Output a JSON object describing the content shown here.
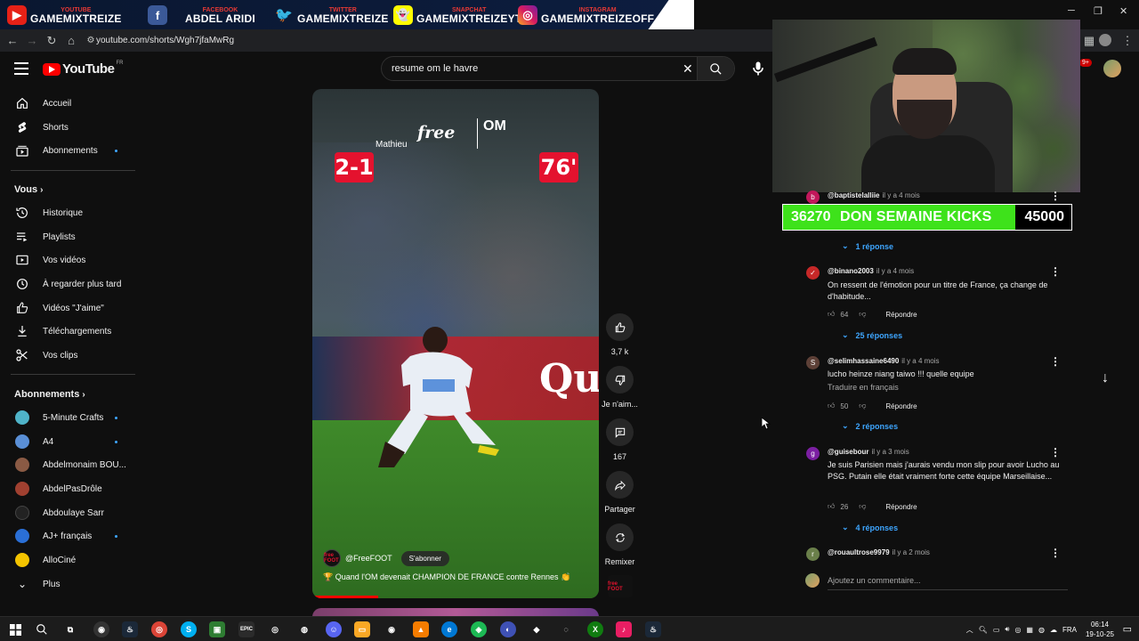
{
  "banner": {
    "youtube": {
      "small": "YOUTUBE",
      "big": "GAMEMIXTREIZE"
    },
    "facebook": {
      "small": "FACEBOOK",
      "big": "ABDEL ARIDI"
    },
    "twitter": {
      "small": "TWITTER",
      "big": "GAMEMIXTREIZE"
    },
    "snapchat": {
      "small": "SNAPCHAT",
      "big": "GAMEMIXTREIZEYT"
    },
    "instagram": {
      "small": "INSTAGRAM",
      "big": "GAMEMIXTREIZEOFF"
    }
  },
  "browser": {
    "url": "youtube.com/shorts/Wgh7jfaMwRg"
  },
  "header": {
    "logo_text": "YouTube",
    "country": "FR",
    "search_query": "resume om le havre",
    "notif_badge": "9+"
  },
  "sidebar": {
    "main": [
      {
        "label": "Accueil",
        "icon": "home-icon"
      },
      {
        "label": "Shorts",
        "icon": "shorts-icon"
      },
      {
        "label": "Abonnements",
        "icon": "subscriptions-icon"
      }
    ],
    "you_heading": "Vous",
    "you": [
      {
        "label": "Historique",
        "icon": "history-icon"
      },
      {
        "label": "Playlists",
        "icon": "playlists-icon"
      },
      {
        "label": "Vos vidéos",
        "icon": "your-videos-icon"
      },
      {
        "label": "À regarder plus tard",
        "icon": "watch-later-icon"
      },
      {
        "label": "Vidéos \"J'aime\"",
        "icon": "liked-videos-icon"
      },
      {
        "label": "Téléchargements",
        "icon": "downloads-icon"
      },
      {
        "label": "Vos clips",
        "icon": "clips-icon"
      }
    ],
    "subs_heading": "Abonnements",
    "subs": [
      {
        "label": "5-Minute Crafts",
        "color": "#4fb3c8"
      },
      {
        "label": "A4",
        "color": "#5a8fd6"
      },
      {
        "label": "Abdelmonaim BOU...",
        "color": "#8a5a44"
      },
      {
        "label": "AbdelPasDrôle",
        "color": "#a04030"
      },
      {
        "label": "Abdoulaye Sarr",
        "color": "#222222"
      },
      {
        "label": "AJ+ français",
        "color": "#2a6fd6"
      },
      {
        "label": "AlloCiné",
        "color": "#f4c400"
      }
    ],
    "more": "Plus"
  },
  "video": {
    "score_left": "2-1",
    "score_right": "76'",
    "scorer": "Mathieu",
    "sponsor": "free",
    "club": "OM",
    "channel": "@FreeFOOT",
    "channel_avatar": "free FOOT",
    "subscribe": "S'abonner",
    "caption": "🏆 Quand l'OM devenait CHAMPION DE FRANCE contre Rennes 👏",
    "progress": 0.23
  },
  "actions": {
    "like_count": "3,7 k",
    "dislike_label": "Je n'aim...",
    "comment_count": "167",
    "share_label": "Partager",
    "remix_label": "Remixer"
  },
  "donation": {
    "current": "36270",
    "title": "DON SEMAINE KICKS",
    "goal": "45000",
    "progress": 0.806
  },
  "comments": [
    {
      "user": "@baptistelalliie",
      "time": "il y a 4 mois",
      "avatar": "b",
      "color": "#c2185b",
      "text": "",
      "likes": "",
      "replies": "1 réponse"
    },
    {
      "user": "@binano2003",
      "time": "il y a 4 mois",
      "avatar": "✓",
      "color": "#c62828",
      "text": "On ressent de l'émotion pour un titre de France, ça change de d'habitude...",
      "likes": "64",
      "replies": "25 réponses"
    },
    {
      "user": "@selimhassaine6490",
      "time": "il y a 4 mois",
      "avatar": "S",
      "color": "#5d4037",
      "text": "lucho heinze niang taiwo !!! quelle equipe",
      "translate": "Traduire en français",
      "likes": "50",
      "replies": "2 réponses"
    },
    {
      "user": "@guisebour",
      "time": "il y a 3 mois",
      "avatar": "g",
      "color": "#7b1fa2",
      "text": "Je suis Parisien mais j'aurais vendu mon slip pour avoir Lucho au PSG. Putain elle était vraiment forte cette équipe Marseillaise...",
      "likes": "26",
      "replies": "4 réponses"
    },
    {
      "user": "@rouaultrose9979",
      "time": "il y a 2 mois",
      "avatar": "r",
      "color": "#6a7f4a",
      "text": "",
      "likes": "",
      "replies": ""
    }
  ],
  "reply_label": "Répondre",
  "add_comment_placeholder": "Ajoutez un commentaire...",
  "taskbar": {
    "lang": "FRA",
    "time": "06:14",
    "date": "19-10-25"
  }
}
